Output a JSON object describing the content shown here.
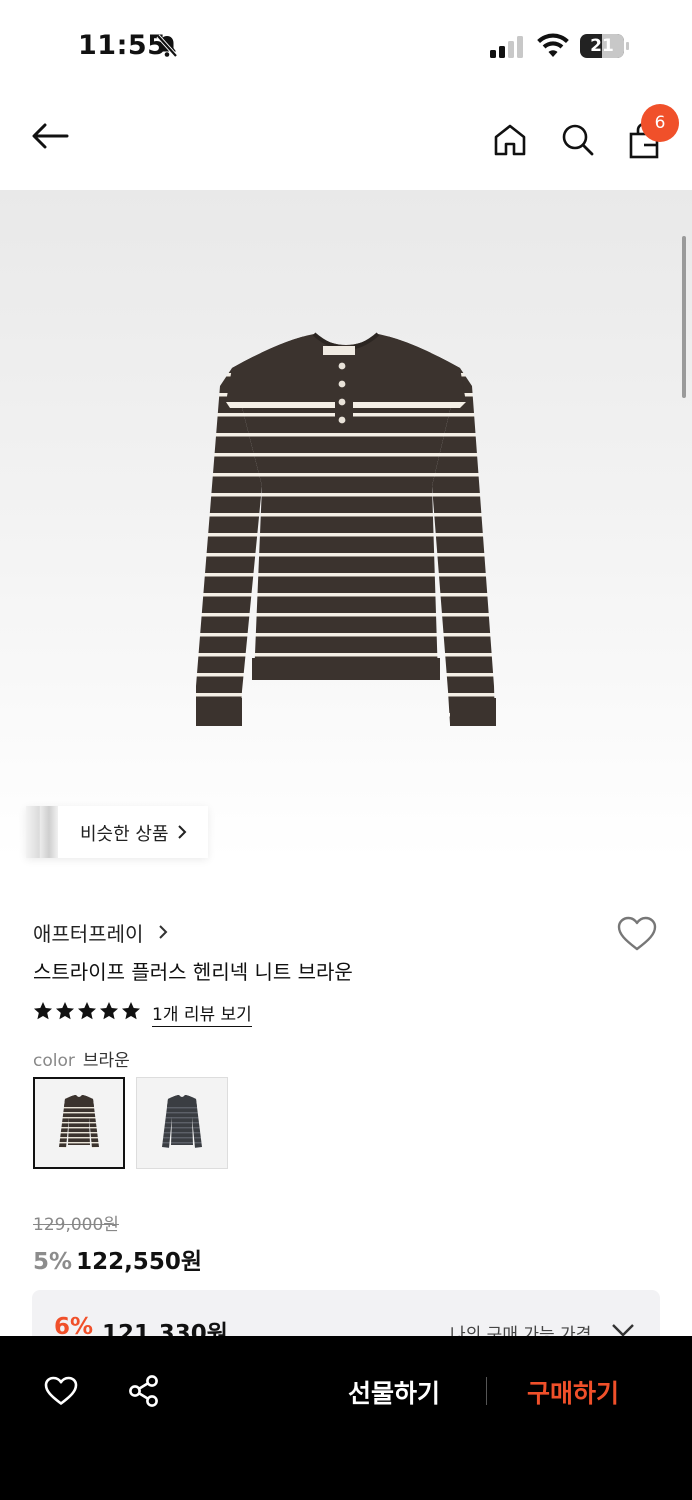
{
  "status_bar": {
    "time": "11:55",
    "battery": "21"
  },
  "nav": {
    "cart_count": "6"
  },
  "similar_products": {
    "label": "비슷한 상품"
  },
  "product": {
    "brand": "애프터프레이",
    "name": "스트라이프 플러스 헨리넥 니트 브라운",
    "rating_stars": 5,
    "review_link": "1개 리뷰 보기",
    "color_key": "color",
    "color_value": "브라운",
    "original_price": "129,000원",
    "discount_pct": "5%",
    "price": "122,550원"
  },
  "my_price": {
    "discount_pct": "6%",
    "price": "121,330원",
    "label": "나의 구매 가능 가격"
  },
  "bottom_bar": {
    "gift_label": "선물하기",
    "buy_label": "구매하기"
  },
  "colors": {
    "accent": "#f0502a",
    "sweater": "#3b332e"
  },
  "icons": [
    "bell-slash-icon",
    "signal-icon",
    "wifi-icon",
    "battery-icon",
    "back-arrow-icon",
    "home-icon",
    "search-icon",
    "shopping-bag-icon",
    "chevron-right-icon",
    "heart-icon",
    "star-icon",
    "chevron-down-icon",
    "share-icon"
  ]
}
